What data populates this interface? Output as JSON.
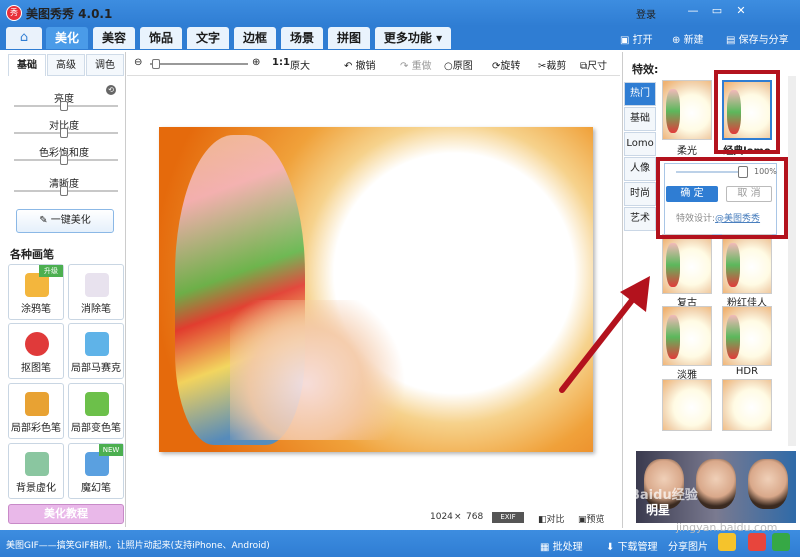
{
  "app": {
    "title": "美图秀秀 4.0.1",
    "logo_text": "秀"
  },
  "window": {
    "login": "登录",
    "minimize": "—",
    "restore": "▭",
    "close": "✕"
  },
  "nav": {
    "home": "⌂",
    "tabs": [
      "美化",
      "美容",
      "饰品",
      "文字",
      "边框",
      "场景",
      "拼图",
      "更多功能 ▾"
    ],
    "open": "打开",
    "new": "新建",
    "save_share": "保存与分享"
  },
  "toolbar": {
    "zoom_in": "⊕",
    "zoom_out": "⊖",
    "actual": "1:1",
    "original_size": "原大",
    "undo": "撤销",
    "redo": "重做",
    "original_image": "原图",
    "rotate": "旋转",
    "crop": "裁剪",
    "size": "尺寸"
  },
  "left": {
    "tabs": [
      "基础",
      "高级",
      "调色"
    ],
    "sliders": [
      {
        "label": "亮度",
        "value": 0.5
      },
      {
        "label": "对比度",
        "value": 0.5
      },
      {
        "label": "色彩饱和度",
        "value": 0.5
      },
      {
        "label": "清晰度",
        "value": 0.5
      }
    ],
    "reset": "⟲",
    "one_key": "一键美化",
    "brush_header": "各种画笔",
    "brushes": [
      {
        "label": "涂鸦笔",
        "badge": "升级"
      },
      {
        "label": "消除笔",
        "badge": ""
      },
      {
        "label": "抠图笔",
        "badge": ""
      },
      {
        "label": "局部马赛克",
        "badge": ""
      },
      {
        "label": "局部彩色笔",
        "badge": ""
      },
      {
        "label": "局部变色笔",
        "badge": ""
      },
      {
        "label": "背景虚化",
        "badge": ""
      },
      {
        "label": "魔幻笔",
        "badge": "NEW"
      }
    ],
    "tutorial": "美化教程"
  },
  "status": {
    "width": "1024",
    "x": "×",
    "height": "768",
    "exif": "EXIF",
    "compare": "对比",
    "preview": "预览"
  },
  "right": {
    "header": "特效:",
    "categories": [
      "热门",
      "基础",
      "Lomo",
      "人像",
      "时尚",
      "艺术"
    ],
    "effects": [
      "柔光",
      "经典lomo",
      "复古",
      "粉红佳人",
      "淡雅",
      "HDR"
    ],
    "popup": {
      "percent": "100%",
      "ok": "确 定",
      "cancel": "取 消",
      "design_label": "特效设计:",
      "design_link": "@美图秀秀"
    },
    "banner_text": "明星"
  },
  "bottom": {
    "tip": "美图GIF——搞笑GIF相机，让照片动起来(支持iPhone、Android)",
    "batch": "批处理",
    "download": "下载管理",
    "share": "分享图片"
  },
  "watermark": {
    "line1": "Baidu经验",
    "line2": "jingyan.baidu.com"
  },
  "colors": {
    "accent": "#2f7dd3",
    "highlight": "#b3121d"
  }
}
